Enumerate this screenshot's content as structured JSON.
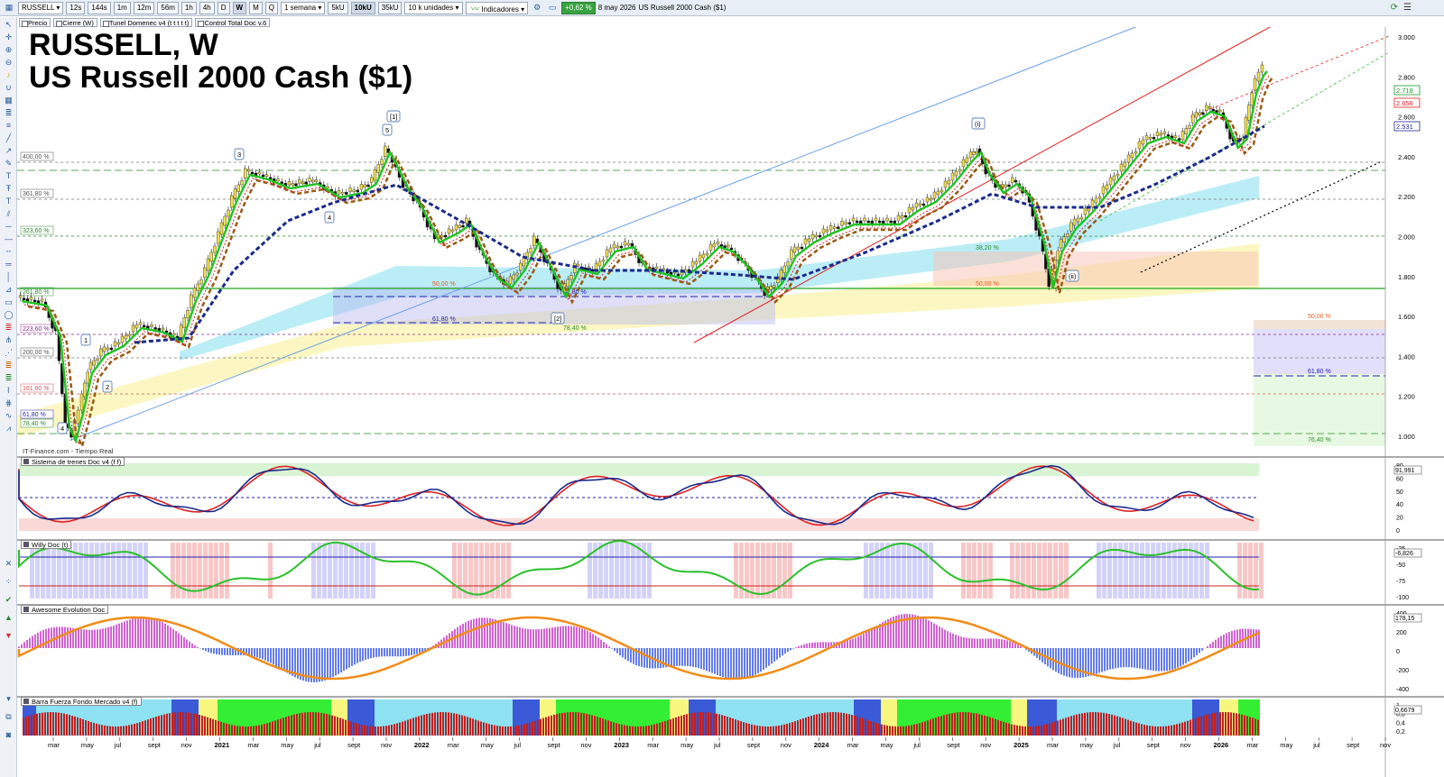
{
  "toolbar": {
    "symbol": "RUSSELL",
    "timeframes": [
      "12s",
      "144s",
      "1m",
      "12m",
      "56m",
      "1h",
      "4h",
      "D",
      "W",
      "M",
      "Q"
    ],
    "active_timeframe": "W",
    "period": "1 semana",
    "units": [
      "5kU",
      "10kU",
      "35kU"
    ],
    "active_unit": "10kU",
    "unit_select": "10 k unidades",
    "indicators_label": "Indicadores",
    "change": "+0,62 %",
    "date": "8 may 2026",
    "instrument": "US Russell 2000 Cash ($1)"
  },
  "indicator_chips": [
    "Precio",
    "Cierre (W)",
    "Tunel Domenec v4 (t t t t t)",
    "Control Total Doc v.6"
  ],
  "chart": {
    "title_line1": "RUSSELL, W",
    "title_line2": "US Russell 2000 Cash ($1)",
    "source": "IT-Finance.com - Tiempo Real",
    "price_axis": [
      "3.000",
      "2.800",
      "2.600",
      "2.400",
      "2.200",
      "2.000",
      "1.800",
      "1.600",
      "1.400",
      "1.200",
      "1.000"
    ],
    "price_tags": [
      {
        "text": "2.718",
        "color": "#1d9a2a"
      },
      {
        "text": "2.656",
        "color": "#d22"
      },
      {
        "text": "2.531",
        "color": "#1a2a8a"
      }
    ],
    "fib_left": [
      {
        "text": "400,00 %",
        "color": "#555"
      },
      {
        "text": "361,80 %",
        "color": "#555"
      },
      {
        "text": "323,60 %",
        "color": "#2a8a2a"
      },
      {
        "text": "261,80 %",
        "color": "#2a8a2a"
      },
      {
        "text": "223,60 %",
        "color": "#8a2a8a"
      },
      {
        "text": "200,00 %",
        "color": "#555"
      },
      {
        "text": "161,80 %",
        "color": "#c55"
      },
      {
        "text": "61,80 %",
        "color": "#22a"
      },
      {
        "text": "78,40 %",
        "color": "#2a8a2a"
      }
    ],
    "fib_mid": [
      {
        "text": "50,00 %",
        "color": "#e06020"
      },
      {
        "text": "61,80 %",
        "color": "#22a"
      },
      {
        "text": "61,80 %",
        "color": "#22a"
      },
      {
        "text": "78,40 %",
        "color": "#2a8a2a"
      },
      {
        "text": "38,20 %",
        "color": "#2a8a2a"
      },
      {
        "text": "50,00 %",
        "color": "#e06020"
      },
      {
        "text": "61,80 %",
        "color": "#22a"
      },
      {
        "text": "61,80 %",
        "color": "#22a"
      }
    ],
    "fib_right": [
      {
        "text": "50,00 %",
        "color": "#e06020"
      },
      {
        "text": "61,80 %",
        "color": "#22a"
      },
      {
        "text": "76,40 %",
        "color": "#2a8a2a"
      }
    ],
    "wave_labels": [
      "1",
      "2",
      "3",
      "4",
      "5",
      "[1]",
      "[2]",
      "(i)",
      "(ii)",
      "4"
    ],
    "x_axis": [
      "mar",
      "may",
      "jul",
      "sept",
      "nov",
      "2021",
      "mar",
      "may",
      "jul",
      "sept",
      "nov",
      "2022",
      "mar",
      "may",
      "jul",
      "sept",
      "nov",
      "2023",
      "mar",
      "may",
      "jul",
      "sept",
      "nov",
      "2024",
      "mar",
      "may",
      "jul",
      "sept",
      "nov",
      "2025",
      "mar",
      "may",
      "jul",
      "sept",
      "nov",
      "2026",
      "mar",
      "may",
      "jul",
      "sept",
      "nov"
    ]
  },
  "panes": {
    "trenes": {
      "title": "Sistema de trenes Doc v4 (f f)",
      "axis": [
        "80",
        "60",
        "50",
        "40",
        "20",
        "0"
      ],
      "tag": "91,991"
    },
    "willy": {
      "title": "Willy Doc (t)",
      "axis": [
        "-25",
        "-50",
        "-75",
        "-100"
      ],
      "tag": "-6,826"
    },
    "awesome": {
      "title": "Awesome Evolution Doc",
      "axis": [
        "400",
        "200",
        "0",
        "-200",
        "-400"
      ],
      "tag": "178,15"
    },
    "barra": {
      "title": "Barra Fuerza Fondo Mercado v4 (f)",
      "axis": [
        "1",
        "0,8",
        "0,4",
        "0,2"
      ],
      "tag": "0,6679"
    }
  },
  "colors": {
    "ema_green": "#1ec41e",
    "ema_red": "#d42020",
    "ema_blue": "#1a2a8a",
    "ema_brown": "#9a5a12",
    "channel_red": "#e02020",
    "channel_blue": "#6a9ee6",
    "band_cyan": "#9ee6f2",
    "band_yellow": "#fbf3a8"
  }
}
